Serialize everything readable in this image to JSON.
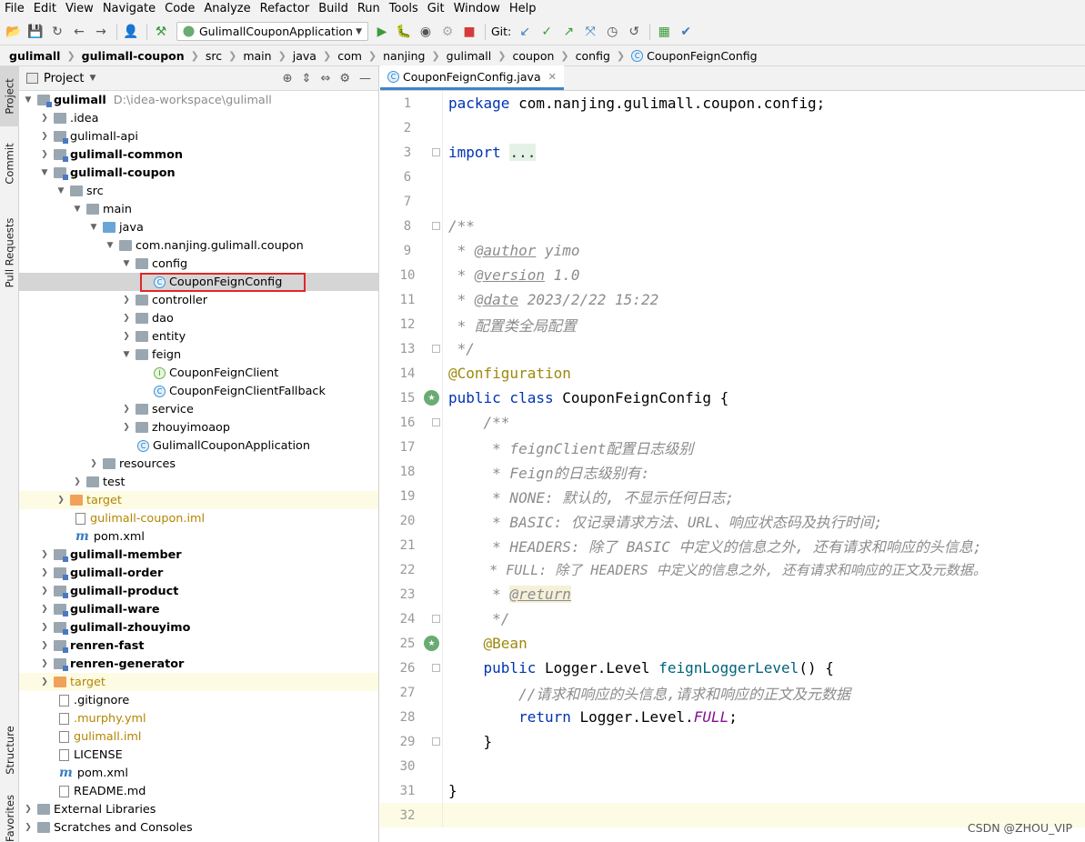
{
  "menu": [
    "File",
    "Edit",
    "View",
    "Navigate",
    "Code",
    "Analyze",
    "Refactor",
    "Build",
    "Run",
    "Tools",
    "Git",
    "Window",
    "Help"
  ],
  "toolbar": {
    "run_config": "GulimallCouponApplication",
    "git_label": "Git:"
  },
  "breadcrumb": [
    "gulimall",
    "gulimall-coupon",
    "src",
    "main",
    "java",
    "com",
    "nanjing",
    "gulimall",
    "coupon",
    "config",
    "CouponFeignConfig"
  ],
  "side_tabs": {
    "project": "Project",
    "commit": "Commit",
    "pull_requests": "Pull Requests",
    "structure": "Structure",
    "favorites": "Favorites"
  },
  "project_panel": {
    "title": "Project"
  },
  "tree": [
    {
      "label": "gulimall",
      "path": "D:\\idea-workspace\\gulimall"
    },
    {
      "label": ".idea"
    },
    {
      "label": "gulimall-api"
    },
    {
      "label": "gulimall-common"
    },
    {
      "label": "gulimall-coupon"
    },
    {
      "label": "src"
    },
    {
      "label": "main"
    },
    {
      "label": "java"
    },
    {
      "label": "com.nanjing.gulimall.coupon"
    },
    {
      "label": "config"
    },
    {
      "label": "CouponFeignConfig"
    },
    {
      "label": "controller"
    },
    {
      "label": "dao"
    },
    {
      "label": "entity"
    },
    {
      "label": "feign"
    },
    {
      "label": "CouponFeignClient"
    },
    {
      "label": "CouponFeignClientFallback"
    },
    {
      "label": "service"
    },
    {
      "label": "zhouyimoaop"
    },
    {
      "label": "GulimallCouponApplication"
    },
    {
      "label": "resources"
    },
    {
      "label": "test"
    },
    {
      "label": "target"
    },
    {
      "label": "gulimall-coupon.iml"
    },
    {
      "label": "pom.xml"
    },
    {
      "label": "gulimall-member"
    },
    {
      "label": "gulimall-order"
    },
    {
      "label": "gulimall-product"
    },
    {
      "label": "gulimall-ware"
    },
    {
      "label": "gulimall-zhouyimo"
    },
    {
      "label": "renren-fast"
    },
    {
      "label": "renren-generator"
    },
    {
      "label": "target"
    },
    {
      "label": ".gitignore"
    },
    {
      "label": ".murphy.yml"
    },
    {
      "label": "gulimall.iml"
    },
    {
      "label": "LICENSE"
    },
    {
      "label": "pom.xml"
    },
    {
      "label": "README.md"
    },
    {
      "label": "External Libraries"
    },
    {
      "label": "Scratches and Consoles"
    }
  ],
  "editor": {
    "tab": "CouponFeignConfig.java",
    "lines": {
      "l1_kw": "package",
      "l1_rest": " com.nanjing.gulimall.coupon.config;",
      "l3_kw": "import",
      "l3_dots": "...",
      "l8": "/**",
      "l9_a": " * ",
      "l9_tag": "@author",
      "l9_b": " yimo",
      "l10_a": " * ",
      "l10_tag": "@version",
      "l10_b": " 1.0",
      "l11_a": " * ",
      "l11_tag": "@date",
      "l11_b": " 2023/2/22 15:22",
      "l12": " * 配置类全局配置",
      "l13": " */",
      "l14": "@Configuration",
      "l15_kw": "public class",
      "l15_rest": " CouponFeignConfig {",
      "l16": "    /**",
      "l17": "     * feignClient配置日志级别",
      "l18": "     * Feign的日志级别有:",
      "l19": "     * NONE: 默认的, 不显示任何日志;",
      "l20": "     * BASIC: 仅记录请求方法、URL、响应状态码及执行时间;",
      "l21": "     * HEADERS: 除了 BASIC 中定义的信息之外, 还有请求和响应的头信息;",
      "l22": "     * FULL: 除了 HEADERS 中定义的信息之外, 还有请求和响应的正文及元数据。",
      "l23_a": "     * ",
      "l23_tag": "@return",
      "l24": "     */",
      "l25": "    @Bean",
      "l26_ind": "    ",
      "l26_kw": "public",
      "l26_a": " Logger.Level ",
      "l26_fn": "feignLoggerLevel",
      "l26_b": "() {",
      "l27": "        //请求和响应的头信息,请求和响应的正文及元数据",
      "l28_ind": "        ",
      "l28_kw": "return",
      "l28_a": " Logger.Level.",
      "l28_fld": "FULL",
      "l28_b": ";",
      "l29": "    }",
      "l31": "}"
    }
  },
  "watermark": "CSDN @ZHOU_VIP",
  "colors": {
    "keyword": "#0033b3",
    "annotation": "#9e880d",
    "comment": "#8c8c8c",
    "highlight_box": "#e0262a",
    "selection": "#d5d5d5"
  }
}
